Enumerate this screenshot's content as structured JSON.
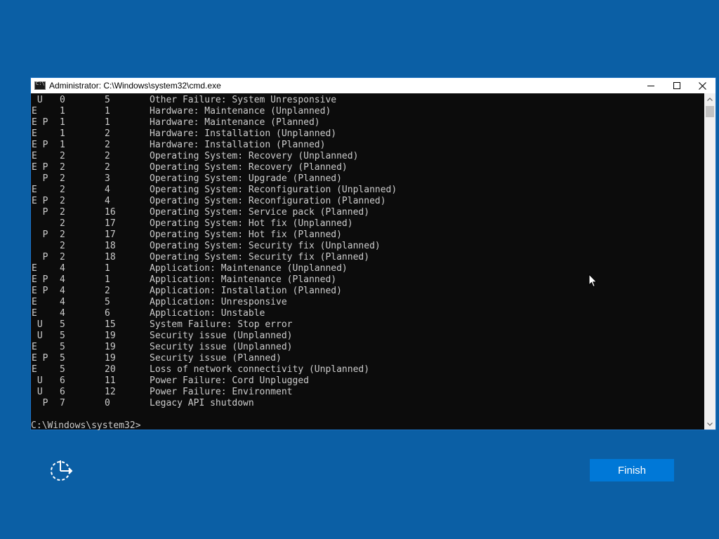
{
  "window": {
    "title": "Administrator: C:\\Windows\\system32\\cmd.exe",
    "controls": {
      "minimize": "minimize-icon",
      "maximize": "maximize-icon",
      "close": "close-icon"
    }
  },
  "console": {
    "rows": [
      {
        "flags": " U",
        "major": "0",
        "minor": "5",
        "desc": "Other Failure: System Unresponsive"
      },
      {
        "flags": "E",
        "major": "1",
        "minor": "1",
        "desc": "Hardware: Maintenance (Unplanned)"
      },
      {
        "flags": "E P",
        "major": "1",
        "minor": "1",
        "desc": "Hardware: Maintenance (Planned)"
      },
      {
        "flags": "E",
        "major": "1",
        "minor": "2",
        "desc": "Hardware: Installation (Unplanned)"
      },
      {
        "flags": "E P",
        "major": "1",
        "minor": "2",
        "desc": "Hardware: Installation (Planned)"
      },
      {
        "flags": "E",
        "major": "2",
        "minor": "2",
        "desc": "Operating System: Recovery (Unplanned)"
      },
      {
        "flags": "E P",
        "major": "2",
        "minor": "2",
        "desc": "Operating System: Recovery (Planned)"
      },
      {
        "flags": "  P",
        "major": "2",
        "minor": "3",
        "desc": "Operating System: Upgrade (Planned)"
      },
      {
        "flags": "E",
        "major": "2",
        "minor": "4",
        "desc": "Operating System: Reconfiguration (Unplanned)"
      },
      {
        "flags": "E P",
        "major": "2",
        "minor": "4",
        "desc": "Operating System: Reconfiguration (Planned)"
      },
      {
        "flags": "  P",
        "major": "2",
        "minor": "16",
        "desc": "Operating System: Service pack (Planned)"
      },
      {
        "flags": "",
        "major": "2",
        "minor": "17",
        "desc": "Operating System: Hot fix (Unplanned)"
      },
      {
        "flags": "  P",
        "major": "2",
        "minor": "17",
        "desc": "Operating System: Hot fix (Planned)"
      },
      {
        "flags": "",
        "major": "2",
        "minor": "18",
        "desc": "Operating System: Security fix (Unplanned)"
      },
      {
        "flags": "  P",
        "major": "2",
        "minor": "18",
        "desc": "Operating System: Security fix (Planned)"
      },
      {
        "flags": "E",
        "major": "4",
        "minor": "1",
        "desc": "Application: Maintenance (Unplanned)"
      },
      {
        "flags": "E P",
        "major": "4",
        "minor": "1",
        "desc": "Application: Maintenance (Planned)"
      },
      {
        "flags": "E P",
        "major": "4",
        "minor": "2",
        "desc": "Application: Installation (Planned)"
      },
      {
        "flags": "E",
        "major": "4",
        "minor": "5",
        "desc": "Application: Unresponsive"
      },
      {
        "flags": "E",
        "major": "4",
        "minor": "6",
        "desc": "Application: Unstable"
      },
      {
        "flags": " U",
        "major": "5",
        "minor": "15",
        "desc": "System Failure: Stop error"
      },
      {
        "flags": " U",
        "major": "5",
        "minor": "19",
        "desc": "Security issue (Unplanned)"
      },
      {
        "flags": "E",
        "major": "5",
        "minor": "19",
        "desc": "Security issue (Unplanned)"
      },
      {
        "flags": "E P",
        "major": "5",
        "minor": "19",
        "desc": "Security issue (Planned)"
      },
      {
        "flags": "E",
        "major": "5",
        "minor": "20",
        "desc": "Loss of network connectivity (Unplanned)"
      },
      {
        "flags": " U",
        "major": "6",
        "minor": "11",
        "desc": "Power Failure: Cord Unplugged"
      },
      {
        "flags": " U",
        "major": "6",
        "minor": "12",
        "desc": "Power Failure: Environment"
      },
      {
        "flags": "  P",
        "major": "7",
        "minor": "0",
        "desc": "Legacy API shutdown"
      }
    ],
    "prompt": "C:\\Windows\\system32>"
  },
  "footer": {
    "finish_label": "Finish",
    "accessibility_icon": "accessibility-icon"
  },
  "colors": {
    "desktop_bg": "#0b5fa5",
    "console_bg": "#0c0c0c",
    "console_text": "#cccccc",
    "button_blue": "#0078d7"
  }
}
